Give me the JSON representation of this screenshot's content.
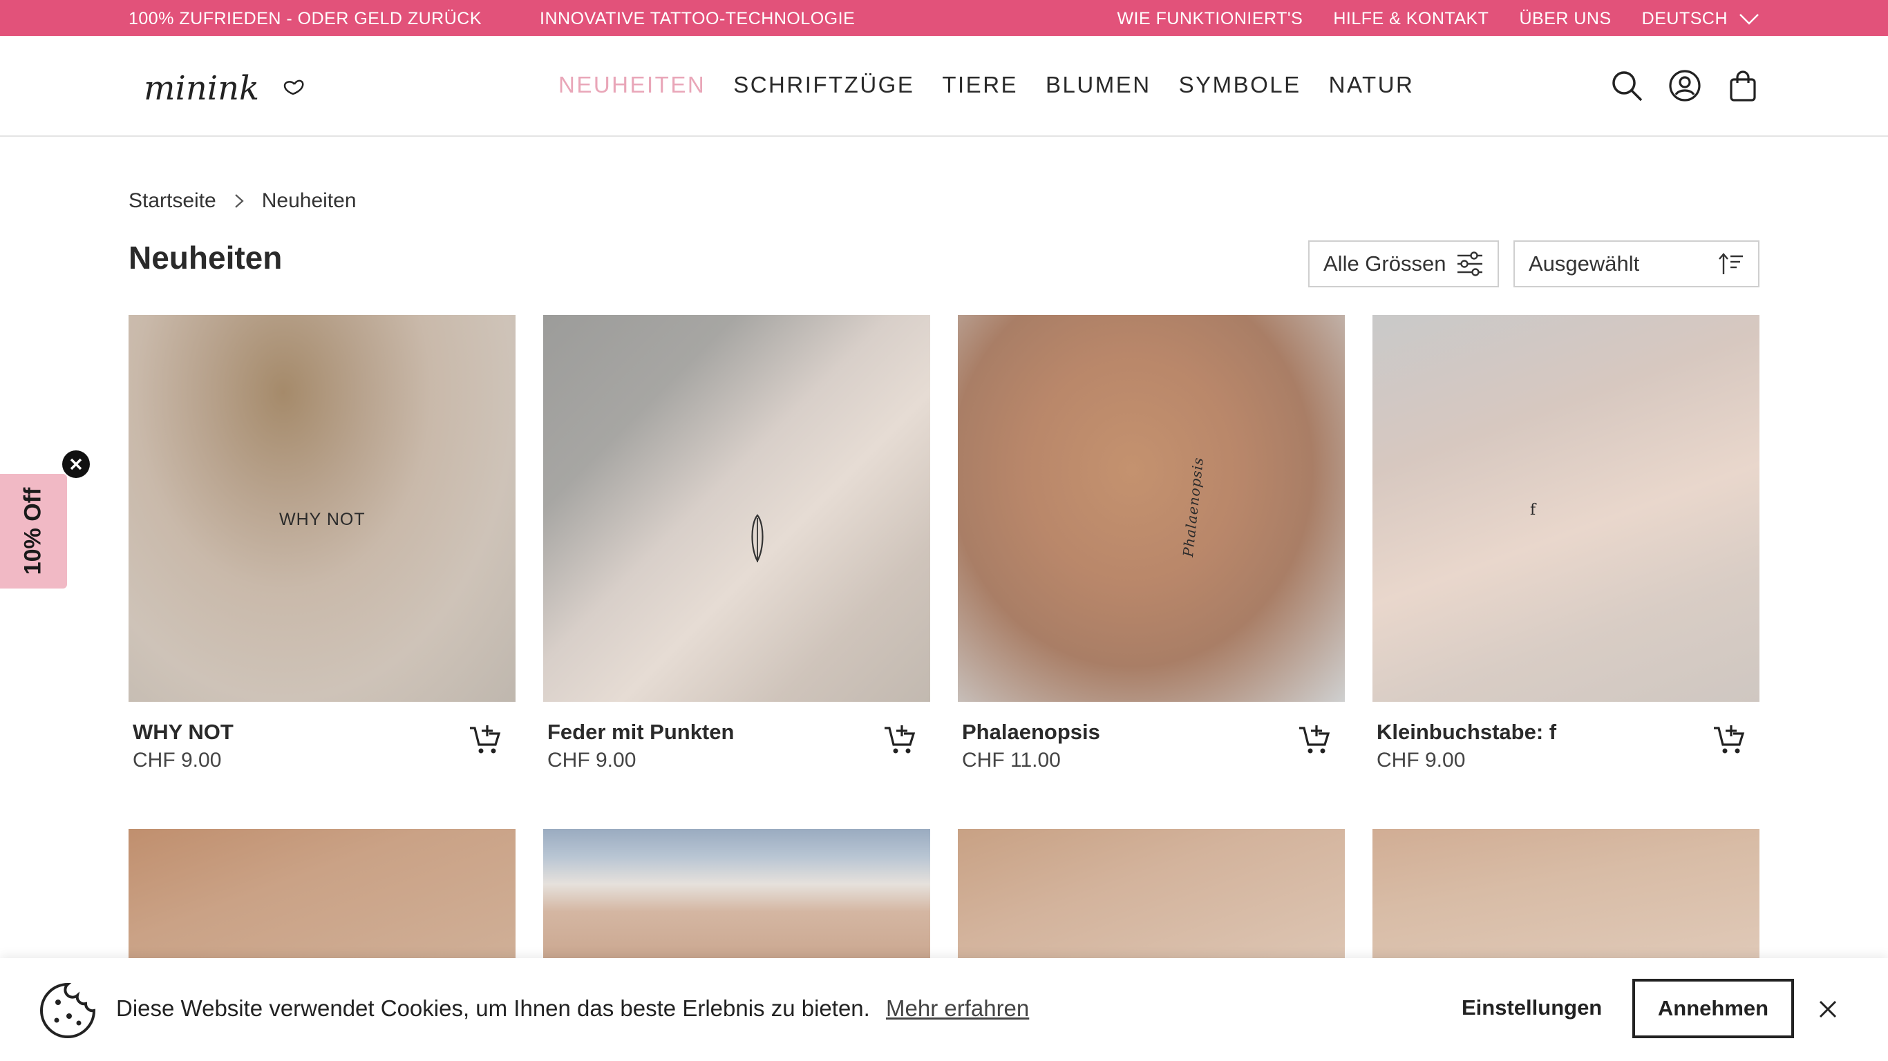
{
  "topbar": {
    "left": [
      "100% ZUFRIEDEN - ODER GELD ZURÜCK",
      "INNOVATIVE TATTOO-TECHNOLOGIE"
    ],
    "right": [
      "WIE FUNKTIONIERT'S",
      "HILFE & KONTAKT",
      "ÜBER UNS"
    ],
    "language": "DEUTSCH"
  },
  "header": {
    "logo_text": "minink",
    "nav": [
      "NEUHEITEN",
      "SCHRIFTZÜGE",
      "TIERE",
      "BLUMEN",
      "SYMBOLE",
      "NATUR"
    ],
    "active_nav": "NEUHEITEN",
    "icons": [
      "search-icon",
      "account-icon",
      "cart-icon"
    ]
  },
  "breadcrumb": {
    "home": "Startseite",
    "current": "Neuheiten"
  },
  "page_title": "Neuheiten",
  "filters": {
    "sizes_label": "Alle Grössen",
    "sort_label": "Ausgewählt"
  },
  "products": [
    {
      "name": "WHY NOT",
      "price": "CHF 9.00",
      "tattoo_text": "WHY NOT"
    },
    {
      "name": "Feder mit Punkten",
      "price": "CHF 9.00"
    },
    {
      "name": "Phalaenopsis",
      "price": "CHF 11.00",
      "tattoo_text": "Phalaenopsis"
    },
    {
      "name": "Kleinbuchstabe: f",
      "price": "CHF 9.00",
      "tattoo_text": "f"
    }
  ],
  "promo": {
    "label": "10% Off"
  },
  "cookie": {
    "text": "Diese Website verwendet Cookies, um Ihnen das beste Erlebnis zu bieten.",
    "link": "Mehr erfahren",
    "settings": "Einstellungen",
    "accept": "Annehmen"
  },
  "colors": {
    "topbar": "#e2527a",
    "nav_active": "#e9a6b8",
    "promo_tab": "#f1b9c5"
  }
}
